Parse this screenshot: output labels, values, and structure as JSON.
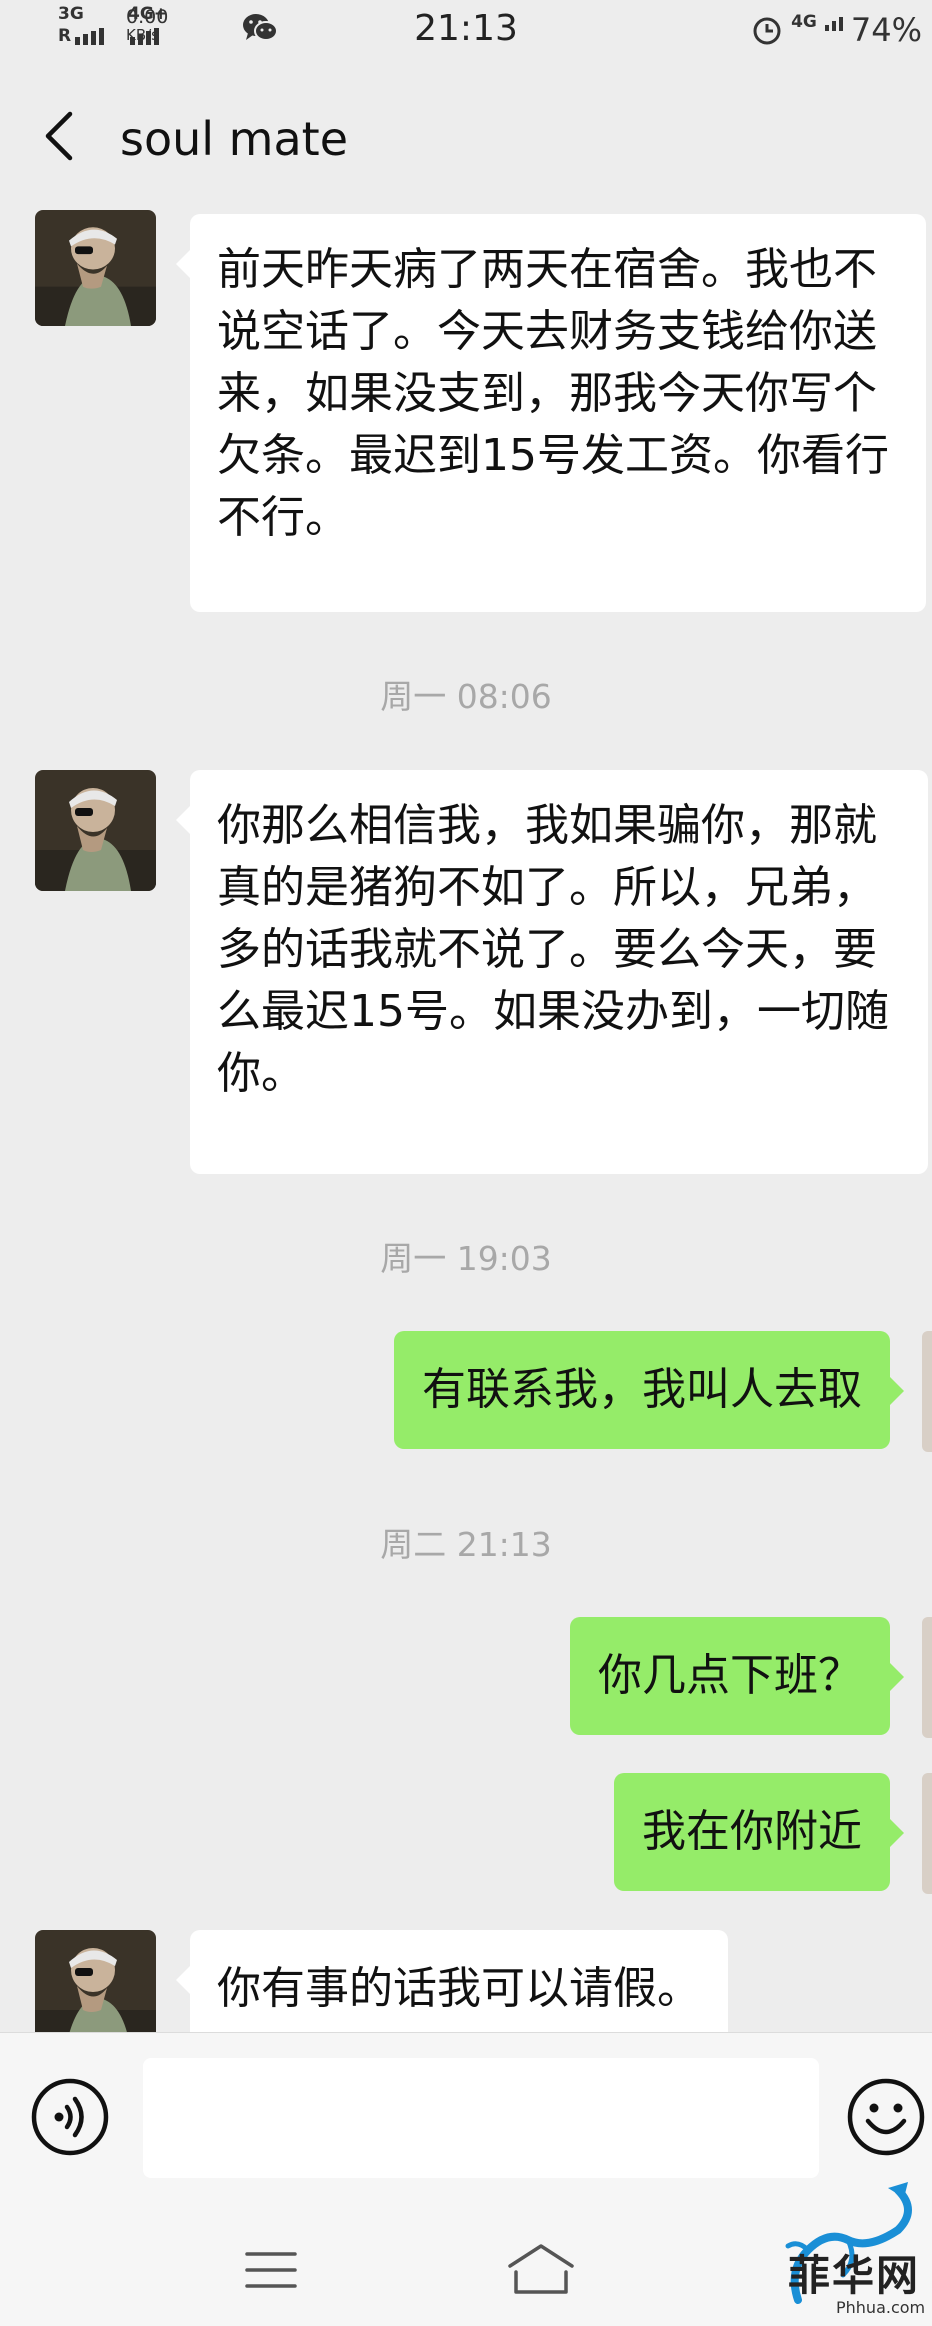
{
  "status_bar": {
    "net1": "3G",
    "net2": "4G+",
    "rate_value": "0.00",
    "rate_unit": "KB/s",
    "time": "21:13",
    "right_network": "4G",
    "battery": "74%"
  },
  "header": {
    "title": "soul mate"
  },
  "messages": [
    {
      "type": "in",
      "text": "前天昨天病了两天在宿舍。我也不说空话了。今天去财务支钱给你送来，如果没支到，那我今天你写个欠条。最迟到15号发工资。你看行不行。"
    },
    {
      "type": "time",
      "text": "周一 08:06"
    },
    {
      "type": "in",
      "text": "你那么相信我，我如果骗你，那就真的是猪狗不如了。所以，兄弟，多的话我就不说了。要么今天，要么最迟15号。如果没办到，一切随你。"
    },
    {
      "type": "time",
      "text": "周一 19:03"
    },
    {
      "type": "out",
      "text": "有联系我，我叫人去取"
    },
    {
      "type": "time",
      "text": "周二 21:13"
    },
    {
      "type": "out",
      "text": "你几点下班？"
    },
    {
      "type": "out",
      "text": "我在你附近"
    },
    {
      "type": "in",
      "text": "你有事的话我可以请假。"
    }
  ],
  "watermark": {
    "text": "菲华网",
    "url": "Phhua.com"
  }
}
